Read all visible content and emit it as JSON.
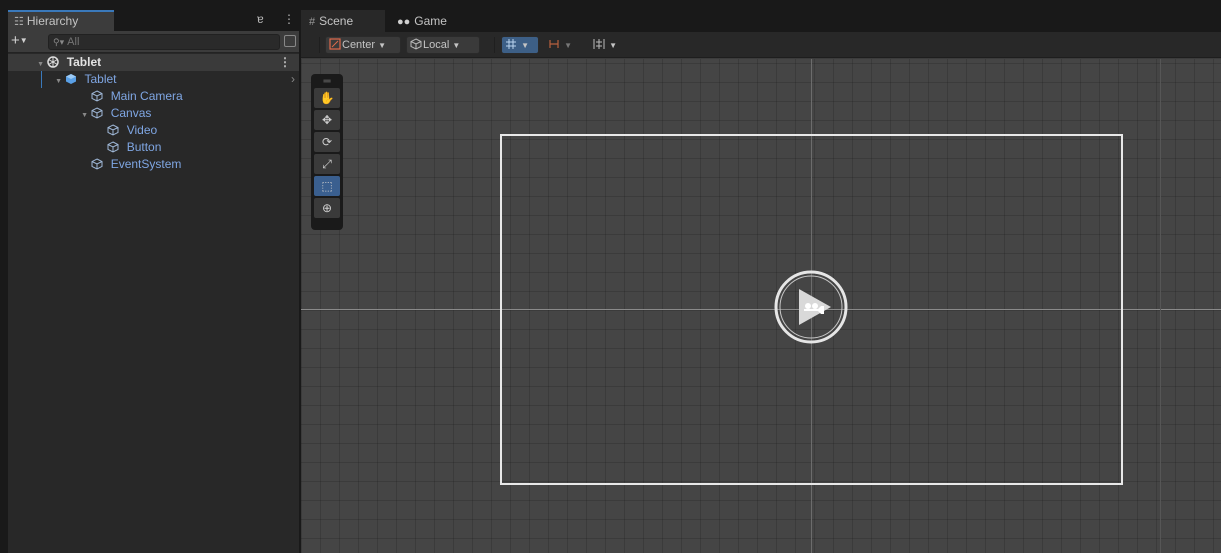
{
  "hierarchy": {
    "tab_label": "Hierarchy",
    "lock_glyph": "ɐ",
    "menu_glyph": "⋮",
    "add_glyph": "+",
    "search_placeholder": "All",
    "scene": {
      "name": "Tablet"
    },
    "items": [
      {
        "label": "Tablet",
        "depth": 1
      },
      {
        "label": "Main Camera",
        "depth": 2
      },
      {
        "label": "Canvas",
        "depth": 2
      },
      {
        "label": "Video",
        "depth": 3
      },
      {
        "label": "Button",
        "depth": 3
      },
      {
        "label": "EventSystem",
        "depth": 2
      }
    ]
  },
  "scene_view": {
    "tabs": {
      "scene": "Scene",
      "game": "Game"
    },
    "toolbar": {
      "pivot": "Center",
      "space": "Local"
    },
    "accent_color": "#3a79bb",
    "tools": [
      "hand-tool",
      "move-tool",
      "rotate-tool",
      "scale-tool",
      "rect-tool",
      "transform-tool"
    ],
    "active_tool": "rect-tool"
  }
}
